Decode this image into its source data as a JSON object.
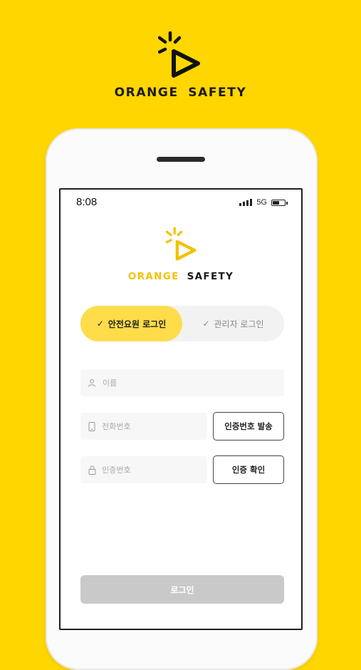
{
  "brand": {
    "name_part1": "ORANGE",
    "name_part2": "SAFETY",
    "accent_color": "#FFD600",
    "mark_color": "#111111",
    "inner_mark_color": "#F2C200"
  },
  "status_bar": {
    "time": "8:08",
    "network": "5G",
    "battery_level": 0.6
  },
  "login_tabs": [
    {
      "label": "안전요원 로그인",
      "active": true
    },
    {
      "label": "관리자 로그인",
      "active": false
    }
  ],
  "form": {
    "name_placeholder": "이름",
    "phone_placeholder": "전화번호",
    "code_placeholder": "인증번호",
    "send_code_label": "인증번호 발송",
    "verify_label": "인증 확인",
    "login_label": "로그인"
  },
  "icons": {
    "name": "user-icon",
    "phone": "phone-icon",
    "code": "lock-icon",
    "check": "check-icon"
  }
}
